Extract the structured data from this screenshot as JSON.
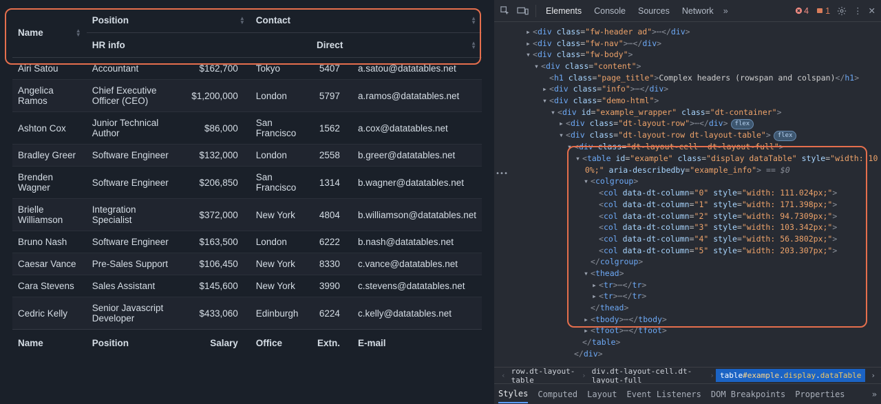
{
  "table": {
    "headers_row1": {
      "name": "Name",
      "position": "Position",
      "contact": "Contact"
    },
    "headers_row2": {
      "hr": "HR info",
      "direct": "Direct"
    },
    "footers": {
      "name": "Name",
      "position": "Position",
      "salary": "Salary",
      "office": "Office",
      "extn": "Extn.",
      "email": "E-mail"
    },
    "rows": [
      {
        "name": "Airi Satou",
        "position": "Accountant",
        "salary": "$162,700",
        "office": "Tokyo",
        "extn": "5407",
        "email": "a.satou@datatables.net"
      },
      {
        "name": "Angelica Ramos",
        "position": "Chief Executive Officer (CEO)",
        "salary": "$1,200,000",
        "office": "London",
        "extn": "5797",
        "email": "a.ramos@datatables.net"
      },
      {
        "name": "Ashton Cox",
        "position": "Junior Technical Author",
        "salary": "$86,000",
        "office": "San Francisco",
        "extn": "1562",
        "email": "a.cox@datatables.net"
      },
      {
        "name": "Bradley Greer",
        "position": "Software Engineer",
        "salary": "$132,000",
        "office": "London",
        "extn": "2558",
        "email": "b.greer@datatables.net"
      },
      {
        "name": "Brenden Wagner",
        "position": "Software Engineer",
        "salary": "$206,850",
        "office": "San Francisco",
        "extn": "1314",
        "email": "b.wagner@datatables.net"
      },
      {
        "name": "Brielle Williamson",
        "position": "Integration Specialist",
        "salary": "$372,000",
        "office": "New York",
        "extn": "4804",
        "email": "b.williamson@datatables.net"
      },
      {
        "name": "Bruno Nash",
        "position": "Software Engineer",
        "salary": "$163,500",
        "office": "London",
        "extn": "6222",
        "email": "b.nash@datatables.net"
      },
      {
        "name": "Caesar Vance",
        "position": "Pre-Sales Support",
        "salary": "$106,450",
        "office": "New York",
        "extn": "8330",
        "email": "c.vance@datatables.net"
      },
      {
        "name": "Cara Stevens",
        "position": "Sales Assistant",
        "salary": "$145,600",
        "office": "New York",
        "extn": "3990",
        "email": "c.stevens@datatables.net"
      },
      {
        "name": "Cedric Kelly",
        "position": "Senior Javascript Developer",
        "salary": "$433,060",
        "office": "Edinburgh",
        "extn": "6224",
        "email": "c.kelly@datatables.net"
      }
    ]
  },
  "devtools": {
    "tabs": [
      "Elements",
      "Console",
      "Sources",
      "Network"
    ],
    "errors": "4",
    "issues": "1",
    "page_title": "Complex headers (rowspan and colspan)",
    "colwidths": [
      "111.024px",
      "171.398px",
      "94.7309px",
      "103.342px",
      "56.3802px",
      "203.307px"
    ],
    "breadcrumb": {
      "a": "row.dt-layout-table",
      "b": "div.dt-layout-cell.dt-layout-full",
      "c": "table#example.display.dataTable"
    },
    "tabs2": [
      "Styles",
      "Computed",
      "Layout",
      "Event Listeners",
      "DOM Breakpoints",
      "Properties"
    ],
    "sel_eq": "== $0"
  }
}
